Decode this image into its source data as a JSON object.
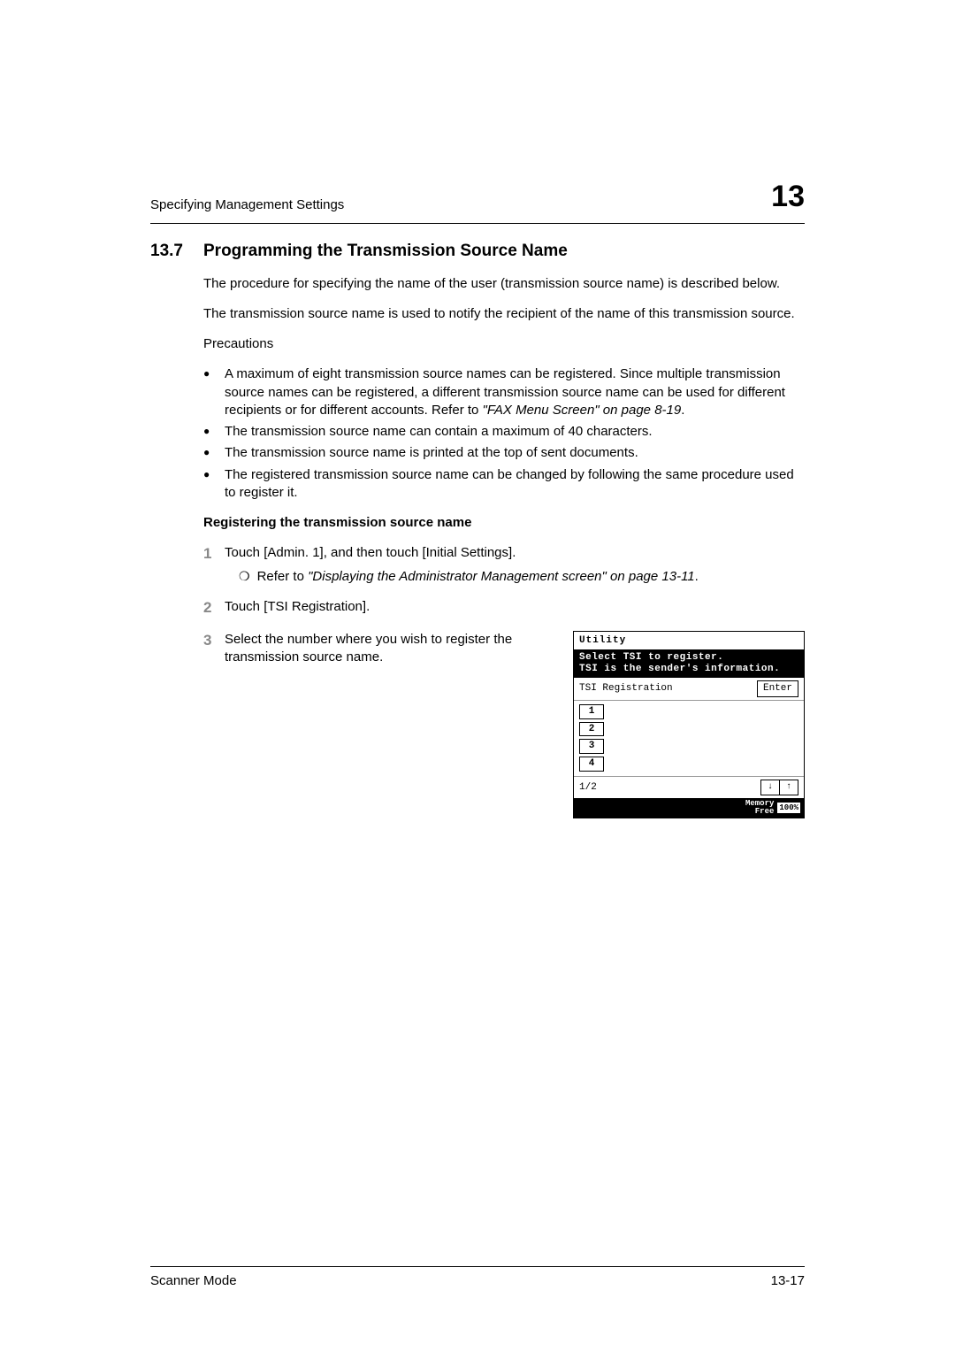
{
  "header": {
    "breadcrumb": "Specifying Management Settings",
    "chapter": "13"
  },
  "section": {
    "number": "13.7",
    "title": "Programming the Transmission Source Name"
  },
  "intro1": "The procedure for specifying the name of the user (transmission source name) is described below.",
  "intro2": "The transmission source name is used to notify the recipient of the name of this transmission source.",
  "precautions_label": "Precautions",
  "bullets": [
    {
      "pre": "A maximum of eight transmission source names can be registered. Since multiple transmission source names can be registered, a different transmission source name can be used for different recipients or for different accounts. Refer to ",
      "ref": "\"FAX Menu Screen\" on page 8-19",
      "post": "."
    },
    {
      "pre": "The transmission source name can contain a maximum of 40 characters.",
      "ref": "",
      "post": ""
    },
    {
      "pre": "The transmission source name is printed at the top of sent documents.",
      "ref": "",
      "post": ""
    },
    {
      "pre": "The registered transmission source name can be changed by following the same procedure used to register it.",
      "ref": "",
      "post": ""
    }
  ],
  "subheading": "Registering the transmission source name",
  "step1": {
    "num": "1",
    "text": "Touch [Admin. 1], and then touch [Initial Settings].",
    "sub_mark": "❍",
    "sub_pre": "Refer to ",
    "sub_ref": "\"Displaying the Administrator Management screen\" on page 13-11",
    "sub_post": "."
  },
  "step2": {
    "num": "2",
    "text": "Touch [TSI Registration]."
  },
  "step3": {
    "num": "3",
    "text": "Select the number where you wish to register the transmission source name."
  },
  "lcd": {
    "title": "Utility",
    "instr1": "Select TSI to register.",
    "instr2": "TSI is the sender's information.",
    "row_label": "TSI Registration",
    "enter": "Enter",
    "slots": [
      "1",
      "2",
      "3",
      "4"
    ],
    "page_indicator": "1/2",
    "arrow_down": "↓",
    "arrow_up": "↑",
    "mem_label1": "Memory",
    "mem_label2": "Free",
    "mem_val": "100%"
  },
  "footer": {
    "left": "Scanner Mode",
    "right": "13-17"
  }
}
